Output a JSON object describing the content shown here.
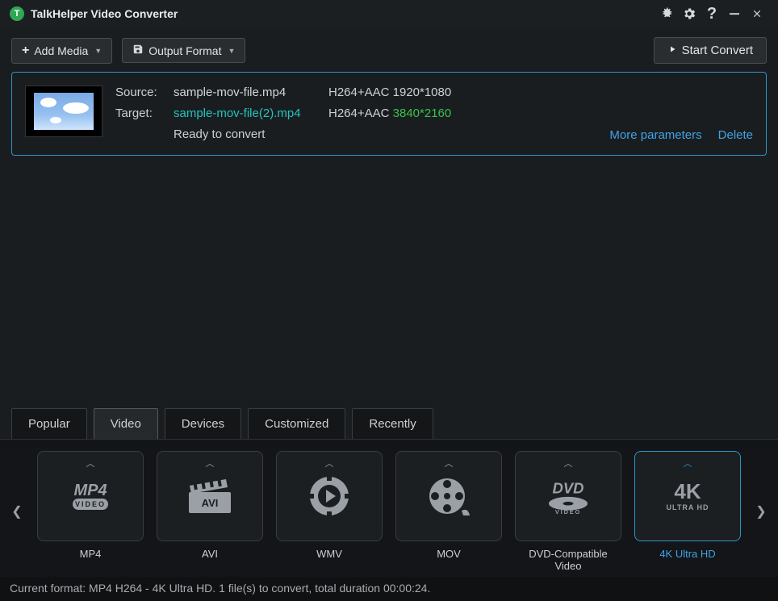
{
  "app": {
    "title": "TalkHelper Video Converter"
  },
  "toolbar": {
    "add_media": "Add Media",
    "output_format": "Output Format",
    "start_convert": "Start Convert"
  },
  "file_item": {
    "source_label": "Source:",
    "target_label": "Target:",
    "source_filename": "sample-mov-file.mp4",
    "target_filename": "sample-mov-file(2).mp4",
    "source_codec": "H264+AAC 1920*1080",
    "target_codec_prefix": "H264+AAC ",
    "target_resolution": "3840*2160",
    "status": "Ready to convert",
    "more_params": "More parameters",
    "delete": "Delete"
  },
  "tabs": [
    "Popular",
    "Video",
    "Devices",
    "Customized",
    "Recently"
  ],
  "active_tab_index": 1,
  "formats": [
    {
      "id": "mp4",
      "label": "MP4"
    },
    {
      "id": "avi",
      "label": "AVI"
    },
    {
      "id": "wmv",
      "label": "WMV"
    },
    {
      "id": "mov",
      "label": "MOV"
    },
    {
      "id": "dvd",
      "label": "DVD-Compatible Video"
    },
    {
      "id": "4k",
      "label": "4K Ultra HD"
    }
  ],
  "selected_format_index": 5,
  "status_bar": "Current format: MP4 H264 - 4K Ultra HD. 1 file(s) to convert, total duration 00:00:24."
}
